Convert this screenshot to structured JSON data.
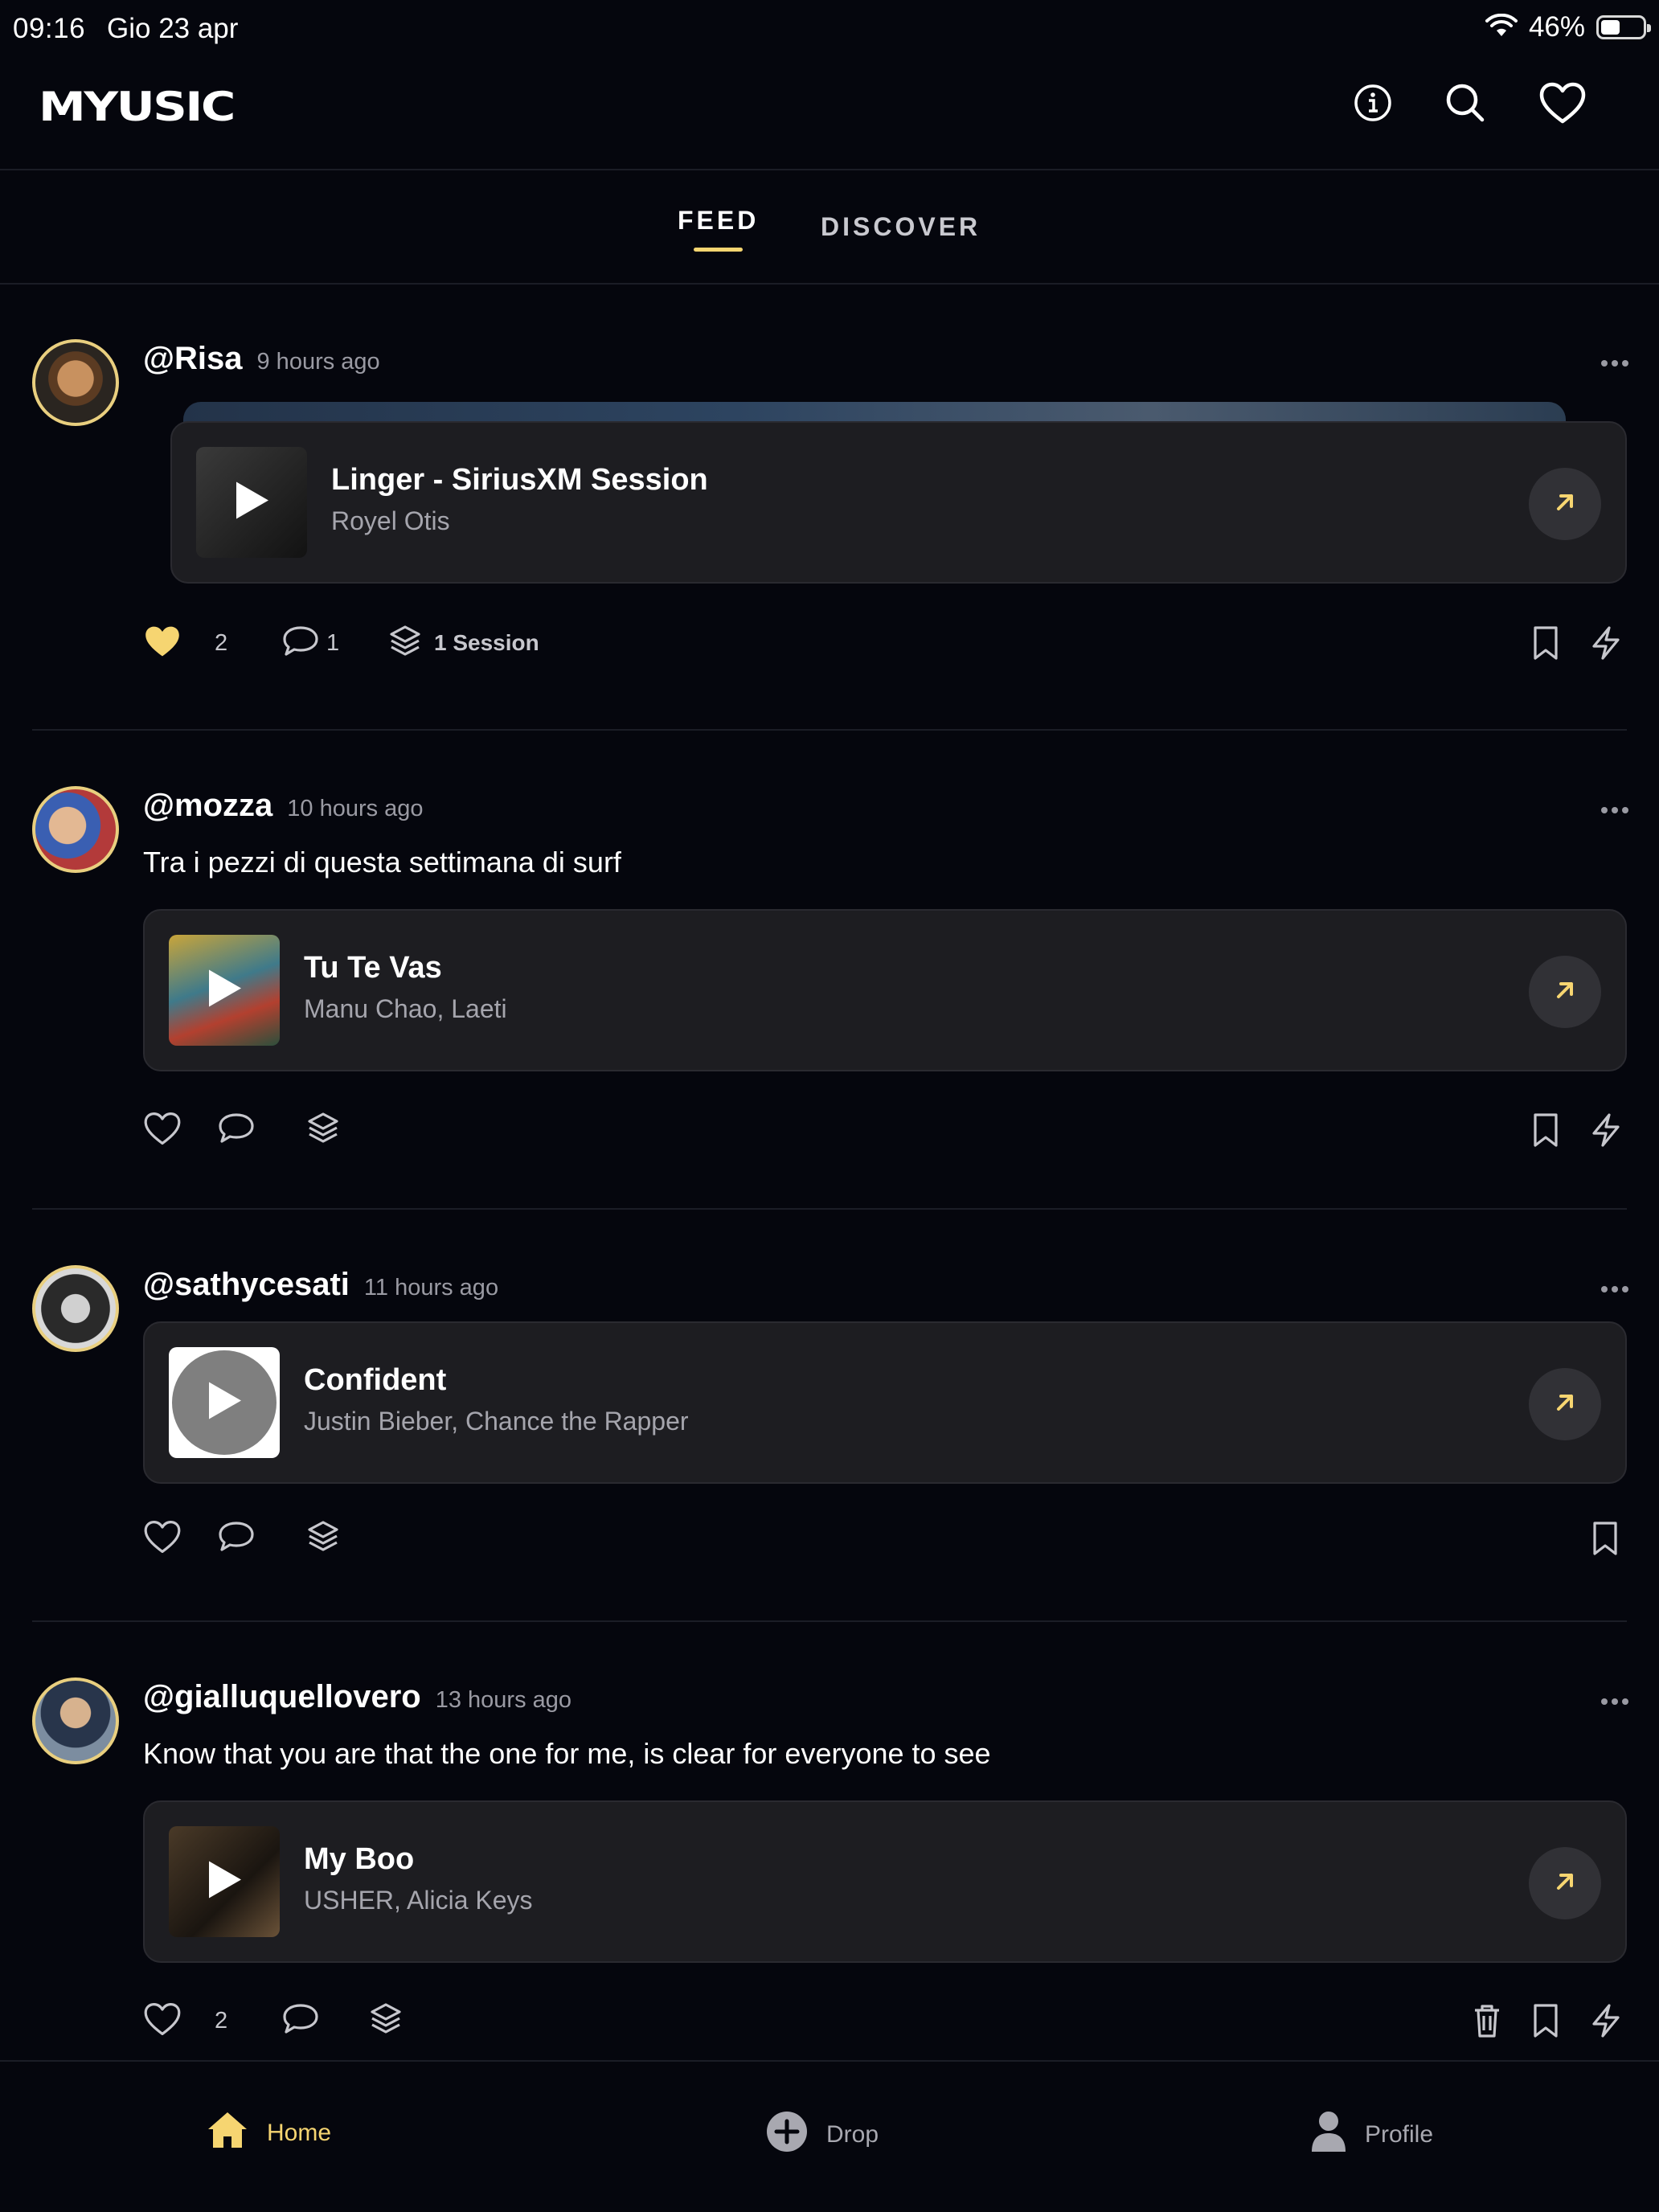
{
  "status_bar": {
    "time": "09:16",
    "date": "Gio 23 apr",
    "battery_text": "46%",
    "battery_level": 0.46
  },
  "header": {
    "logo": "MYUSIC",
    "icons": [
      "info-icon",
      "search-icon",
      "heart-icon"
    ]
  },
  "tabs": [
    {
      "label": "FEED",
      "active": true
    },
    {
      "label": "DISCOVER",
      "active": false
    }
  ],
  "colors": {
    "accent": "#f6d571",
    "background": "#05060d",
    "card": "#1d1d21",
    "muted": "#9a9aa3"
  },
  "posts": [
    {
      "handle": "@Risa",
      "time": "9 hours ago",
      "caption": "",
      "track": {
        "title": "Linger - SiriusXM Session",
        "artist": "Royel Otis"
      },
      "likes": "2",
      "liked": true,
      "comments": "1",
      "sessions": "1 Session"
    },
    {
      "handle": "@mozza",
      "time": "10 hours ago",
      "caption": "Tra i pezzi di questa settimana di surf",
      "track": {
        "title": "Tu Te Vas",
        "artist": "Manu Chao, Laeti"
      },
      "likes": "",
      "liked": false,
      "comments": "",
      "sessions": ""
    },
    {
      "handle": "@sathycesati",
      "time": "11 hours ago",
      "caption": "",
      "track": {
        "title": "Confident",
        "artist": "Justin Bieber, Chance the Rapper"
      },
      "likes": "",
      "liked": false,
      "comments": "",
      "sessions": ""
    },
    {
      "handle": "@gialluquellovero",
      "time": "13 hours ago",
      "caption": "Know that you are that the one for me, is clear for everyone to see",
      "track": {
        "title": "My Boo",
        "artist": "USHER, Alicia Keys"
      },
      "likes": "2",
      "liked": false,
      "comments": "",
      "sessions": ""
    }
  ],
  "bottom_nav": [
    {
      "label": "Home",
      "icon": "home-icon",
      "active": true
    },
    {
      "label": "Drop",
      "icon": "plus-circle-icon",
      "active": false
    },
    {
      "label": "Profile",
      "icon": "person-icon",
      "active": false
    }
  ]
}
